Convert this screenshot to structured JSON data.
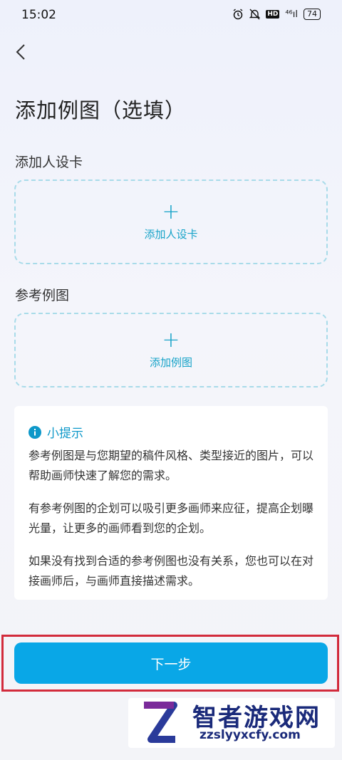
{
  "status": {
    "time": "15:02",
    "signal": "⁴⁶ıl",
    "hd": "HD",
    "battery": "74"
  },
  "header": {
    "title": "添加例图（选填）"
  },
  "section_persona": {
    "label": "添加人设卡",
    "button": "添加人设卡",
    "plus": "+"
  },
  "section_reference": {
    "label": "参考例图",
    "button": "添加例图",
    "plus": "+"
  },
  "tips": {
    "title": "小提示",
    "p1": "参考例图是与您期望的稿件风格、类型接近的图片，可以帮助画师快速了解您的需求。",
    "p2": "有参考例图的企划可以吸引更多画师来应征，提高企划曝光量，让更多的画师看到您的企划。",
    "p3": "如果没有找到合适的参考例图也没有关系，您也可以在对接画师后，与画师直接描述需求。"
  },
  "footer": {
    "next_label": "下一步"
  },
  "watermark": {
    "name": "智者游戏网",
    "url": "zzslyyxcfy.com"
  },
  "colors": {
    "accent": "#09a7e7",
    "link": "#17a3c8",
    "highlight": "#d22b3c"
  }
}
